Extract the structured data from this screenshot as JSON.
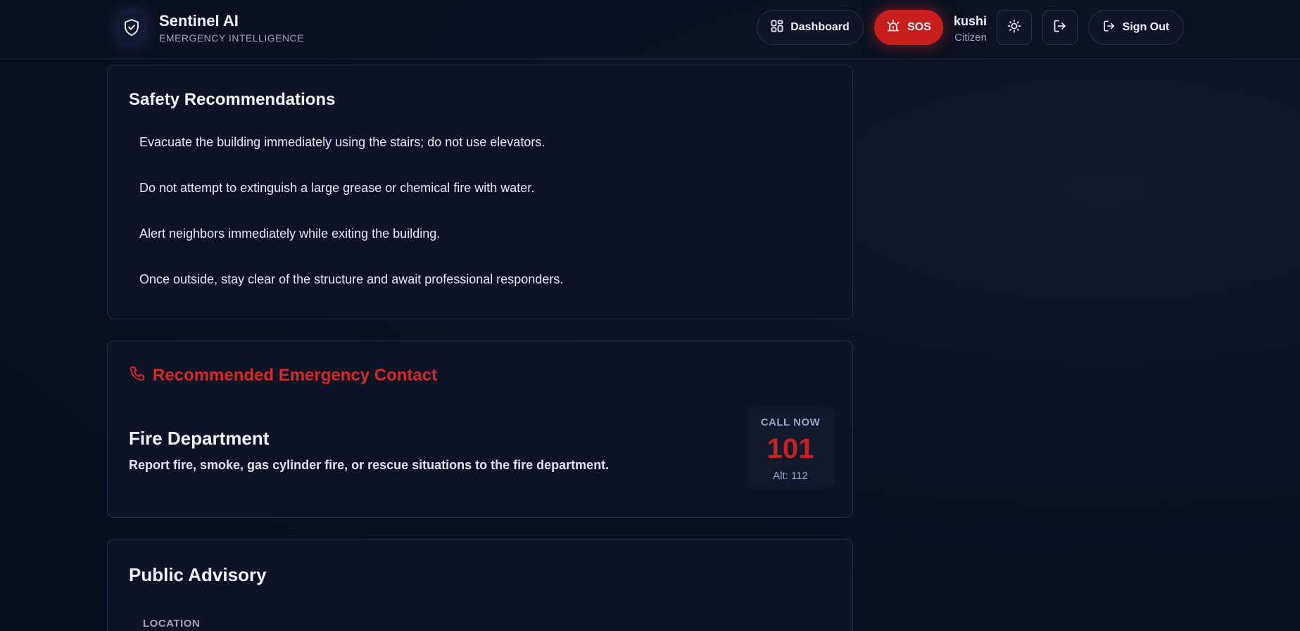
{
  "header": {
    "brand_title": "Sentinel AI",
    "brand_subtitle": "EMERGENCY INTELLIGENCE",
    "dashboard_label": "Dashboard",
    "sos_label": "SOS",
    "user_name": "kushi",
    "user_role": "Citizen",
    "signout_label": "Sign Out"
  },
  "safety": {
    "title": "Safety Recommendations",
    "items": [
      "Evacuate the building immediately using the stairs; do not use elevators.",
      "Do not attempt to extinguish a large grease or chemical fire with water.",
      "Alert neighbors immediately while exiting the building.",
      "Once outside, stay clear of the structure and await professional responders."
    ]
  },
  "contact": {
    "heading": "Recommended Emergency Contact",
    "department": "Fire Department",
    "description": "Report fire, smoke, gas cylinder fire, or rescue situations to the fire department.",
    "call_label": "CALL NOW",
    "number": "101",
    "alt": "Alt: 112"
  },
  "advisory": {
    "title": "Public Advisory",
    "location_label": "LOCATION"
  },
  "colors": {
    "accent_red": "#c81e1e",
    "background": "#0b1120",
    "card": "#0e1526"
  },
  "icons": {
    "brand": "shield-check-icon",
    "dashboard": "layout-grid-icon",
    "sos": "siren-icon",
    "theme": "sun-icon",
    "exit": "log-out-icon",
    "signout": "log-out-icon",
    "contact": "phone-icon"
  }
}
